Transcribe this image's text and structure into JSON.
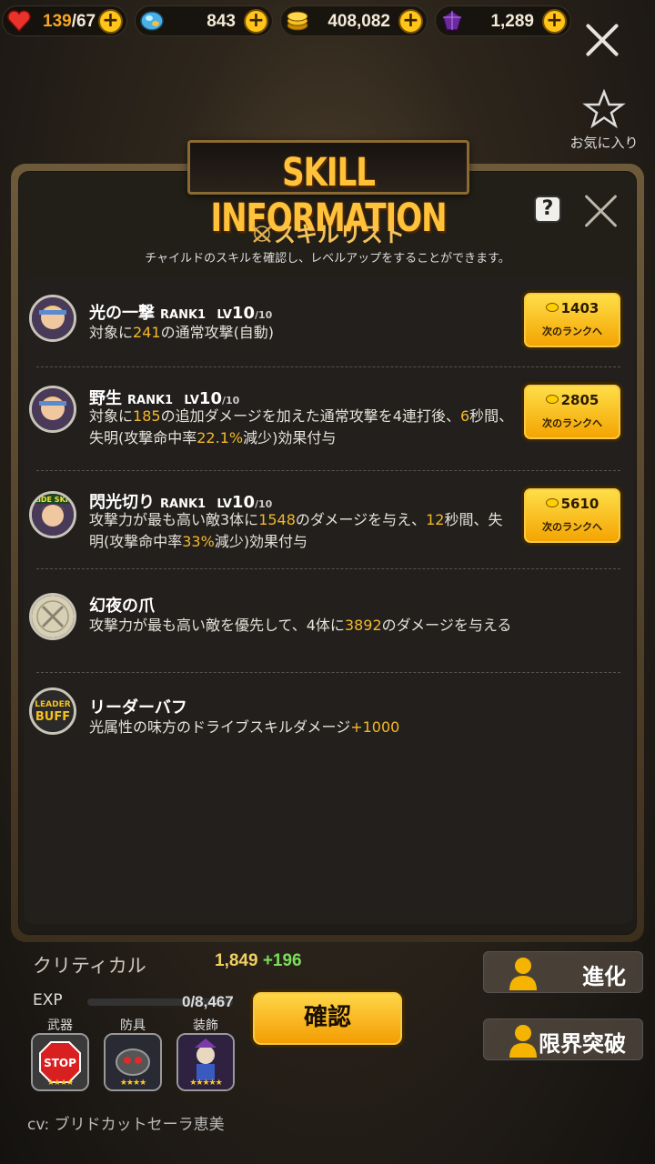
{
  "resources": [
    {
      "icon": "heart-icon",
      "value_current": "139",
      "value_max": "/67"
    },
    {
      "icon": "crystal-icon",
      "value": "843"
    },
    {
      "icon": "gold-coin-icon",
      "value": "408,082"
    },
    {
      "icon": "purple-gem-icon",
      "value": "1,289"
    }
  ],
  "favorite_label": "お気に入り",
  "modal": {
    "banner_title": "SKILL INFORMATION",
    "list_title": "スキルリスト",
    "list_subtitle": "チャイルドのスキルを確認し、レベルアップをすることができます。",
    "help_label": "?"
  },
  "skills": [
    {
      "name": "光の一撃",
      "rank": "RANK1",
      "lv_label": "LV",
      "lv": "10",
      "lv_max": "/10",
      "desc_parts": [
        "対象に",
        "241",
        "の通常攻撃(自動)"
      ],
      "upgrade_cost": "1403",
      "upgrade_label": "次のランクへ"
    },
    {
      "name": "野生",
      "rank": "RANK1",
      "lv_label": "LV",
      "lv": "10",
      "lv_max": "/10",
      "desc_parts": [
        "対象に",
        "185",
        "の追加ダメージを加えた通常攻撃を4連打後、",
        "6",
        "秒間、失明(攻撃命中率",
        "22.1%",
        "減少)効果付与"
      ],
      "upgrade_cost": "2805",
      "upgrade_label": "次のランクへ"
    },
    {
      "name": "閃光切り",
      "rank": "RANK1",
      "lv_label": "LV",
      "lv": "10",
      "lv_max": "/10",
      "badge": "SLIDE SKILL",
      "desc_parts": [
        "攻撃力が最も高い敵3体に",
        "1548",
        "のダメージを与え、",
        "12",
        "秒間、失明(攻撃命中率",
        "33%",
        "減少)効果付与"
      ],
      "upgrade_cost": "5610",
      "upgrade_label": "次のランクへ"
    },
    {
      "name": "幻夜の爪",
      "desc_parts": [
        "攻撃力が最も高い敵を優先して、4体に",
        "3892",
        "のダメージを与える"
      ]
    },
    {
      "name": "リーダーバフ",
      "badge_top": "LEADER",
      "badge_bottom": "BUFF",
      "desc_parts": [
        "光属性の味方のドライブスキルダメージ",
        "+1000"
      ]
    }
  ],
  "background": {
    "crit_label": "クリティカル",
    "crit_value": "1,849",
    "crit_bonus": "+196",
    "exp_label": "EXP",
    "exp_value": "0/8,467",
    "confirm_label": "確認",
    "evolve_label": "進化",
    "limit_break_label": "限界突破",
    "equip_labels": [
      "武器",
      "防具",
      "装飾"
    ],
    "stop_sign": "STOP",
    "cv": "cv: ブリドカットセーラ恵美"
  },
  "colors": {
    "highlight": "#f5b82a",
    "button_gold": "#ffc51a",
    "title_gold": "#ffc23a"
  }
}
